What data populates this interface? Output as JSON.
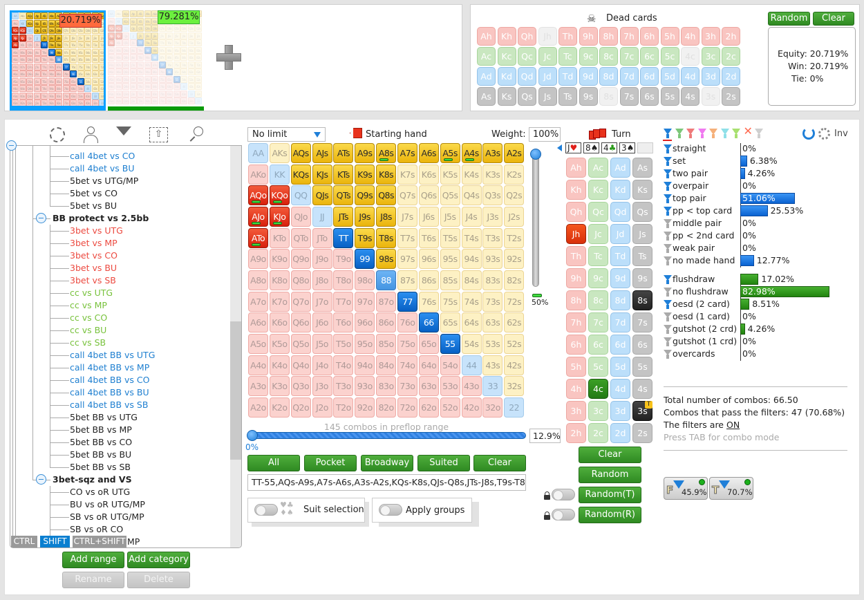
{
  "colors": {
    "accent_blue": "#1f7fd8",
    "button_green": "#3a9a2c",
    "selected_red": "#e8321c",
    "suited_gold": "#f4c21a"
  },
  "ranks": [
    "A",
    "K",
    "Q",
    "J",
    "T",
    "9",
    "8",
    "7",
    "6",
    "5",
    "4",
    "3",
    "2"
  ],
  "top": {
    "thumbnails": [
      {
        "equity": "20.719%",
        "badge_color": "#ff6a3d",
        "selected": true
      },
      {
        "equity": "79.281%",
        "badge_color": "#6cf03e",
        "selected": false
      }
    ],
    "add_icon": "plus-icon"
  },
  "dead_cards": {
    "title": "Dead cards",
    "icon": "skull-icon",
    "suits": [
      "h",
      "c",
      "d",
      "s"
    ],
    "disabled": [
      "Jh",
      "4c",
      "8s",
      "3s"
    ],
    "random_label": "Random",
    "clear_label": "Clear",
    "equity_label": "Equity: 20.719%",
    "win_label": "Win: 20.719%",
    "tie_label": "Tie: 0%"
  },
  "toolbar_icons": [
    "gear-icon",
    "user-icon",
    "filter-icon",
    "export-icon",
    "search-icon"
  ],
  "tree": {
    "items": [
      {
        "text": "call 4bet vs CO",
        "type": "leaf",
        "color": "#1e7fd0"
      },
      {
        "text": "call 4bet vs BU",
        "type": "leaf",
        "color": "#1e7fd0"
      },
      {
        "text": "5bet vs UTG/MP",
        "type": "leaf",
        "color": "#222"
      },
      {
        "text": "5bet vs CO",
        "type": "leaf",
        "color": "#222"
      },
      {
        "text": "5bet vs BU",
        "type": "leaf",
        "color": "#222"
      },
      {
        "text": "BB protect vs 2.5bb",
        "type": "group",
        "color": "#222"
      },
      {
        "text": "3bet vs UTG",
        "type": "leaf",
        "color": "#ec4a40"
      },
      {
        "text": "3bet vs MP",
        "type": "leaf",
        "color": "#ec4a40"
      },
      {
        "text": "3bet vs CO",
        "type": "leaf",
        "color": "#ec4a40"
      },
      {
        "text": "3bet vs BU",
        "type": "leaf",
        "color": "#ec4a40"
      },
      {
        "text": "3bet vs SB",
        "type": "leaf",
        "color": "#ec4a40"
      },
      {
        "text": "cc vs UTG",
        "type": "leaf",
        "color": "#78c23c"
      },
      {
        "text": "cc vs MP",
        "type": "leaf",
        "color": "#78c23c"
      },
      {
        "text": "cc vs CO",
        "type": "leaf",
        "color": "#78c23c"
      },
      {
        "text": "cc vs BU",
        "type": "leaf",
        "color": "#78c23c"
      },
      {
        "text": "cc vs SB",
        "type": "leaf",
        "color": "#78c23c"
      },
      {
        "text": "call 4bet BB vs UTG",
        "type": "leaf",
        "color": "#1e7fd0"
      },
      {
        "text": "call 4bet BB vs MP",
        "type": "leaf",
        "color": "#1e7fd0"
      },
      {
        "text": "call 4bet BB vs CO",
        "type": "leaf",
        "color": "#1e7fd0"
      },
      {
        "text": "call 4bet BB vs BU",
        "type": "leaf",
        "color": "#1e7fd0"
      },
      {
        "text": "call 4bet BB vs SB",
        "type": "leaf",
        "color": "#1e7fd0"
      },
      {
        "text": "5bet BB vs UTG",
        "type": "leaf",
        "color": "#222"
      },
      {
        "text": "5bet BB vs MP",
        "type": "leaf",
        "color": "#222"
      },
      {
        "text": "5bet BB vs CO",
        "type": "leaf",
        "color": "#222"
      },
      {
        "text": "5bet BB vs BU",
        "type": "leaf",
        "color": "#222"
      },
      {
        "text": "5bet BB vs SB",
        "type": "leaf",
        "color": "#222"
      },
      {
        "text": "3bet-sqz and VS",
        "type": "group",
        "color": "#222"
      },
      {
        "text": "CO vs oR UTG",
        "type": "leaf",
        "color": "#222"
      },
      {
        "text": "BU vs oR UTG/MP",
        "type": "leaf",
        "color": "#222"
      },
      {
        "text": "SB vs oR UTG/MP",
        "type": "leaf",
        "color": "#222"
      },
      {
        "text": "SB vs oR CO",
        "type": "leaf",
        "color": "#222"
      },
      {
        "text": "MP",
        "type": "leaf-partial",
        "color": "#222"
      }
    ],
    "modifiers": [
      {
        "label": "CTRL",
        "active": false
      },
      {
        "label": "SHIFT",
        "active": true
      },
      {
        "label": "CTRL+SHIFT",
        "active": false
      }
    ],
    "add_range": "Add range",
    "add_category": "Add category",
    "rename": "Rename",
    "delete": "Delete"
  },
  "range": {
    "limit_select": "No limit",
    "starting_hand_label": "Starting hand",
    "weight_label": "Weight:",
    "weight_value": "100%",
    "weight_slider_pct": 100,
    "weight_min_label": "50%",
    "selected": [
      "TT",
      "99",
      "88",
      "77",
      "66",
      "55",
      "AQs",
      "AJs",
      "ATs",
      "A9s",
      "A8s",
      "A7s",
      "A6s",
      "A5s",
      "A4s",
      "A3s",
      "A2s",
      "KQs",
      "KJs",
      "KTs",
      "K9s",
      "K8s",
      "QJs",
      "QTs",
      "Q9s",
      "Q8s",
      "JTs",
      "J9s",
      "J8s",
      "T9s",
      "T8s",
      "98s",
      "AQo",
      "KQo",
      "AJo",
      "KJo",
      "ATo"
    ],
    "partially_blocked": [
      "88"
    ],
    "weighted": [
      "A8s",
      "A5s",
      "A4s",
      "AQo",
      "KQo",
      "AJo",
      "KJo",
      "ATo"
    ],
    "combos_label": "145 combos in preflop range",
    "percent_slider_value": 0,
    "percent_slider_label": "0%",
    "percent_value": "12.9%",
    "buttons": [
      "All",
      "Pocket",
      "Broadway",
      "Suited",
      "Clear"
    ],
    "range_text": "TT-55,AQs-A9s,A7s-A6s,A3s-A2s,KQs-K8s,QJs-Q8s,JTs-J8s,T9s-T8s,",
    "suit_selection_label": "Suit selection",
    "apply_groups_label": "Apply groups"
  },
  "board": {
    "street_label": "Turn",
    "cards": [
      {
        "rank": "J",
        "suit": "♥",
        "color": "#e0201a"
      },
      {
        "rank": "8",
        "suit": "♠",
        "color": "#222"
      },
      {
        "rank": "4",
        "suit": "♣",
        "color": "#2a9a1a"
      },
      {
        "rank": "3",
        "suit": "♠",
        "color": "#222"
      },
      {
        "rank": "",
        "suit": "",
        "color": "#222"
      }
    ],
    "selected": {
      "Jh": "c-selh",
      "4c": "c-selc",
      "8s": "c-sels",
      "3s": "c-sels"
    },
    "turn_badge_card": "3s",
    "turn_badge": "T",
    "buttons": [
      "Clear",
      "Random",
      "Random(T)",
      "Random(R)"
    ]
  },
  "stats": {
    "filter_colors": [
      "#1f7fd8",
      "#7dc77a",
      "#ef7a7a",
      "#f07af0",
      "#f5b07a",
      "#8fe0e8",
      "#a8e070",
      "#ff6a50",
      "#cfcfcf"
    ],
    "inv_label": "Inv",
    "made_hands": [
      {
        "label": "straight",
        "value": "0%",
        "pct": 0,
        "active": true
      },
      {
        "label": "set",
        "value": "6.38%",
        "pct": 6.38,
        "active": true
      },
      {
        "label": "two pair",
        "value": "4.26%",
        "pct": 4.26,
        "active": true
      },
      {
        "label": "overpair",
        "value": "0%",
        "pct": 0,
        "active": true
      },
      {
        "label": "top pair",
        "value": "51.06%",
        "pct": 51.06,
        "active": true
      },
      {
        "label": "pp < top card",
        "value": "25.53%",
        "pct": 25.53,
        "active": true
      },
      {
        "label": "middle pair",
        "value": "0%",
        "pct": 0,
        "active": false
      },
      {
        "label": "pp < 2nd card",
        "value": "0%",
        "pct": 0,
        "active": false
      },
      {
        "label": "weak pair",
        "value": "0%",
        "pct": 0,
        "active": false
      },
      {
        "label": "no made hand",
        "value": "12.77%",
        "pct": 12.77,
        "active": false
      }
    ],
    "draws": [
      {
        "label": "flushdraw",
        "value": "17.02%",
        "pct": 17.02,
        "active": true
      },
      {
        "label": "no flushdraw",
        "value": "82.98%",
        "pct": 82.98,
        "active": false
      },
      {
        "label": "oesd (2 card)",
        "value": "8.51%",
        "pct": 8.51,
        "active": true
      },
      {
        "label": "oesd (1 card)",
        "value": "0%",
        "pct": 0,
        "active": false
      },
      {
        "label": "gutshot (2 crd)",
        "value": "4.26%",
        "pct": 4.26,
        "active": false
      },
      {
        "label": "gutshot (1 crd)",
        "value": "0%",
        "pct": 0,
        "active": false
      },
      {
        "label": "overcards",
        "value": "0%",
        "pct": 0,
        "active": false
      }
    ],
    "total_combos": "Total number of combos: 66.50",
    "pass_combos": "Combos that pass the filters: 47 (70.68%)",
    "filters_prefix": "The filters are ",
    "filters_state": "ON",
    "tab_hint": "Press TAB for combo mode",
    "badges": [
      {
        "letter": "F",
        "value": "45.9%"
      },
      {
        "letter": "T",
        "value": "70.7%"
      }
    ]
  }
}
